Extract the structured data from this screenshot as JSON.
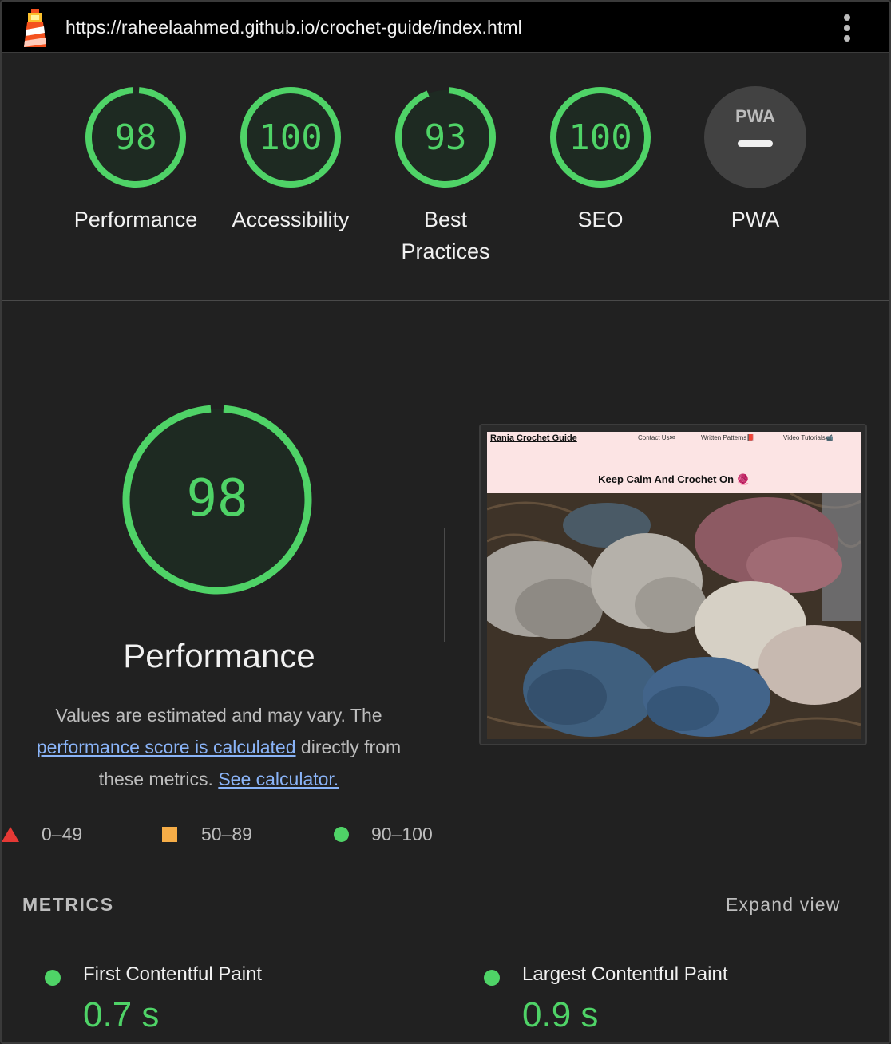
{
  "topbar": {
    "url": "https://raheelaahmed.github.io/crochet-guide/index.html"
  },
  "scores": [
    {
      "label": "Performance",
      "score": "98",
      "value": 98
    },
    {
      "label": "Accessibility",
      "score": "100",
      "value": 100
    },
    {
      "label": "Best Practices",
      "score": "93",
      "value": 93
    },
    {
      "label": "SEO",
      "score": "100",
      "value": 100
    },
    {
      "label": "PWA",
      "badge": "PWA"
    }
  ],
  "performance": {
    "score": "98",
    "value": 98,
    "title": "Performance",
    "desc_prefix": "Values are estimated and may vary. The ",
    "desc_link": "performance score is calculated",
    "desc_middle": " directly from these metrics. ",
    "calc_link": "See calculator."
  },
  "legend": {
    "fail": "0–49",
    "average": "50–89",
    "pass": "90–100"
  },
  "screenshot": {
    "brand": "Rania Crochet Guide",
    "links": [
      "Contact Us✉",
      "Written Patterns📕",
      "Video Tutorials📹"
    ],
    "tagline": "Keep Calm And Crochet On 🧶"
  },
  "metrics": {
    "heading": "METRICS",
    "expand": "Expand view",
    "items": [
      {
        "name": "First Contentful Paint",
        "value": "0.7 s"
      },
      {
        "name": "Largest Contentful Paint",
        "value": "0.9 s"
      }
    ]
  },
  "colors": {
    "pass": "#4fd367",
    "average": "#f6ad47",
    "fail": "#e53935",
    "link": "#8ab4f8",
    "gauge_bg": "#1e2a22"
  }
}
